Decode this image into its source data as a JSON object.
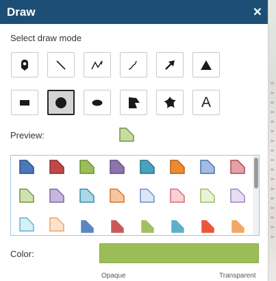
{
  "window": {
    "title": "Draw",
    "close_glyph": "×"
  },
  "mode_section": {
    "label": "Select draw mode",
    "modes": [
      {
        "name": "point",
        "icon": "pin-icon",
        "selected": false
      },
      {
        "name": "line",
        "icon": "line-icon",
        "selected": false
      },
      {
        "name": "polyline",
        "icon": "polyline-icon",
        "selected": false
      },
      {
        "name": "freehand-polyline",
        "icon": "freehand-line-icon",
        "selected": false
      },
      {
        "name": "arrow",
        "icon": "arrow-icon",
        "selected": false
      },
      {
        "name": "triangle",
        "icon": "triangle-icon",
        "selected": false
      },
      {
        "name": "rectangle",
        "icon": "rectangle-icon",
        "selected": false
      },
      {
        "name": "circle",
        "icon": "circle-icon",
        "selected": true
      },
      {
        "name": "ellipse",
        "icon": "ellipse-icon",
        "selected": false
      },
      {
        "name": "polygon",
        "icon": "polygon-icon",
        "selected": false
      },
      {
        "name": "freehand-polygon",
        "icon": "freehand-polygon-icon",
        "selected": false
      },
      {
        "name": "text",
        "icon": "text-icon",
        "label": "A",
        "selected": false
      }
    ]
  },
  "preview": {
    "label": "Preview:",
    "fill": "#c6dca0",
    "outline": "#6f9440"
  },
  "symbols": [
    {
      "shape": "flag",
      "fill": "#4a78b8",
      "stroke": "#2a4f86"
    },
    {
      "shape": "flag",
      "fill": "#c24747",
      "stroke": "#8e2b2b"
    },
    {
      "shape": "flag",
      "fill": "#9bbd58",
      "stroke": "#6a8c33"
    },
    {
      "shape": "flag",
      "fill": "#8f72b0",
      "stroke": "#5f4a80"
    },
    {
      "shape": "flag",
      "fill": "#47a3be",
      "stroke": "#2a7186"
    },
    {
      "shape": "flag",
      "fill": "#ee8a2f",
      "stroke": "#b45e16"
    },
    {
      "shape": "flag",
      "fill": "#a3bde4",
      "stroke": "#4a6ea8"
    },
    {
      "shape": "flag",
      "fill": "#e4a1a6",
      "stroke": "#b04a52"
    },
    {
      "shape": "flag",
      "fill": "#cfe1b2",
      "stroke": "#6f9440"
    },
    {
      "shape": "flag",
      "fill": "#c5b8dc",
      "stroke": "#7a66a0"
    },
    {
      "shape": "flag",
      "fill": "#a9d8e6",
      "stroke": "#3d8aa3"
    },
    {
      "shape": "flag",
      "fill": "#f8c59e",
      "stroke": "#cc7633"
    },
    {
      "shape": "flag",
      "fill": "#dde6f6",
      "stroke": "#6f8fc6"
    },
    {
      "shape": "flag",
      "fill": "#f8d1d3",
      "stroke": "#d56a71"
    },
    {
      "shape": "flag",
      "fill": "#eaf3d6",
      "stroke": "#9cc05e"
    },
    {
      "shape": "flag",
      "fill": "#e6ddf2",
      "stroke": "#9b86c2"
    },
    {
      "shape": "flag",
      "fill": "#d6f0f6",
      "stroke": "#5bb6cc"
    },
    {
      "shape": "flag",
      "fill": "#fde3cd",
      "stroke": "#f0a060"
    },
    {
      "shape": "wedge",
      "fill": "#5b86c4",
      "stroke": "#5b86c4"
    },
    {
      "shape": "wedge",
      "fill": "#c95a5a",
      "stroke": "#c95a5a"
    },
    {
      "shape": "wedge",
      "fill": "#a2c062",
      "stroke": "#a2c062"
    },
    {
      "shape": "wedge",
      "fill": "#5eb0c8",
      "stroke": "#5eb0c8"
    },
    {
      "shape": "wedge",
      "fill": "#e9573a",
      "stroke": "#e9573a"
    },
    {
      "shape": "wedge",
      "fill": "#f3a766",
      "stroke": "#f3a766"
    }
  ],
  "color": {
    "label": "Color:",
    "value": "#9bbd58"
  },
  "transparency": {
    "min_label": "Opaque",
    "max_label": "Transparent"
  }
}
